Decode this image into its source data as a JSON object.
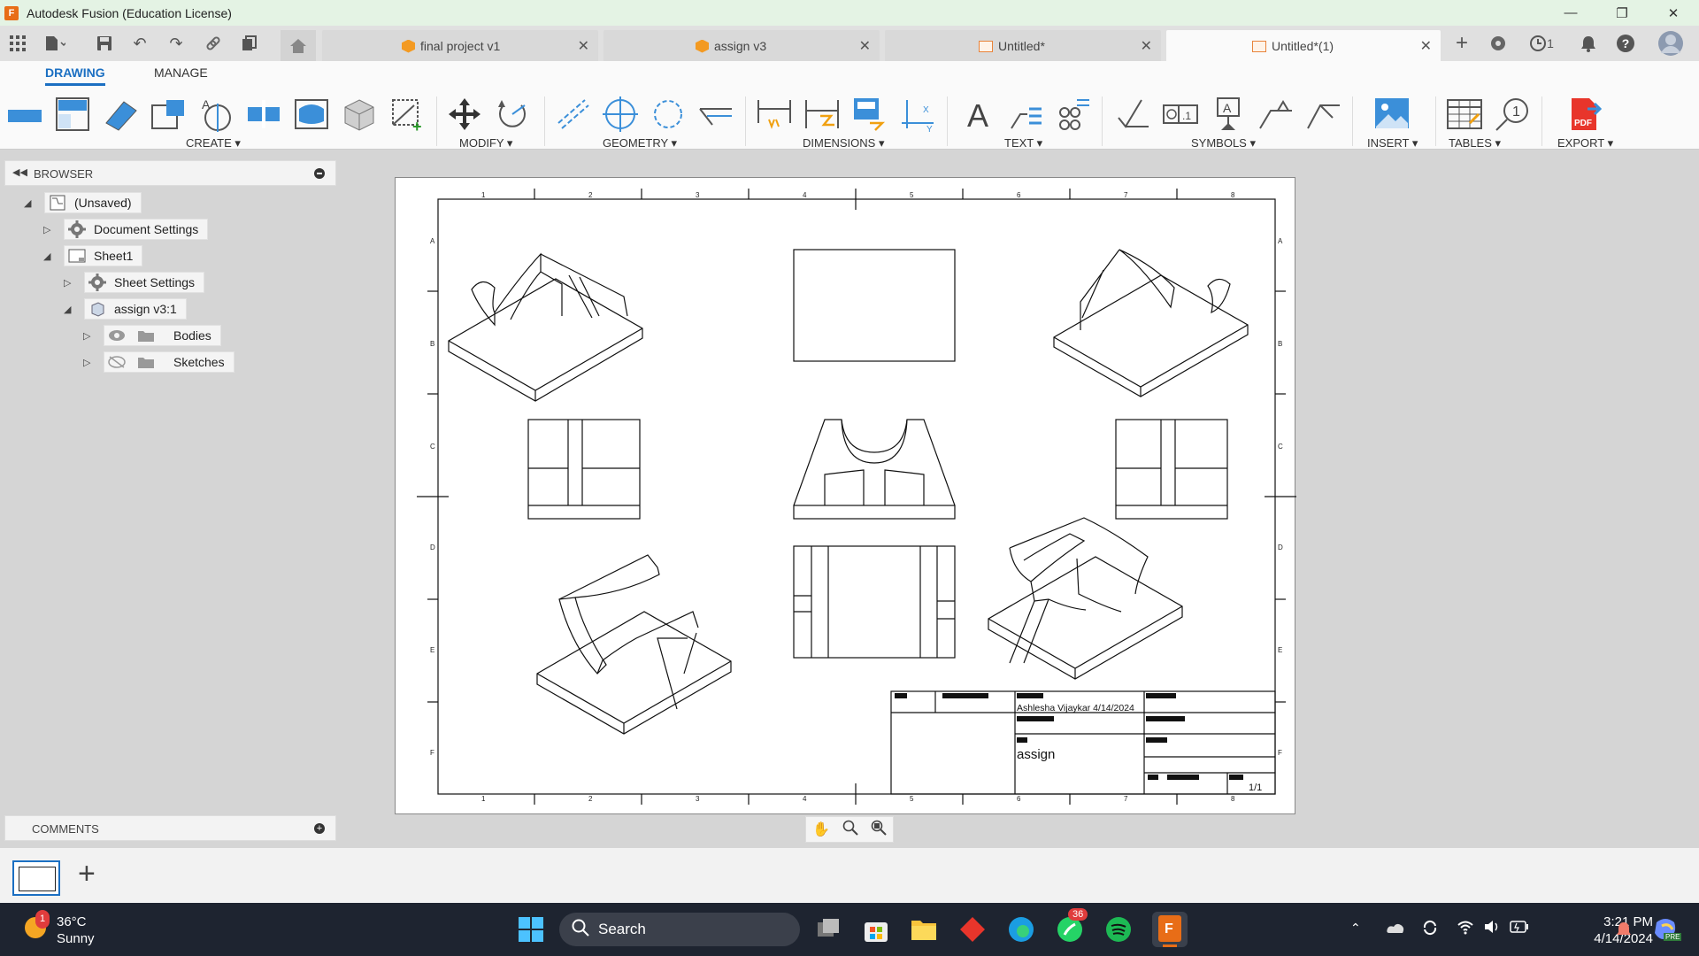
{
  "window": {
    "title": "Autodesk Fusion (Education License)",
    "app_letter": "F"
  },
  "tabs": [
    {
      "label": "final project v1",
      "active": false
    },
    {
      "label": "assign v3",
      "active": false
    },
    {
      "label": "Untitled*",
      "active": false
    },
    {
      "label": "Untitled*(1)",
      "active": true
    }
  ],
  "notifications": {
    "jobs_count": "1"
  },
  "ribbon": {
    "tabs": [
      "DRAWING",
      "MANAGE"
    ],
    "groups": {
      "create": "CREATE ▾",
      "modify": "MODIFY ▾",
      "geometry": "GEOMETRY ▾",
      "dimensions": "DIMENSIONS ▾",
      "text": "TEXT ▾",
      "symbols": "SYMBOLS ▾",
      "insert": "INSERT ▾",
      "tables": "TABLES ▾",
      "export": "EXPORT ▾"
    },
    "pdf_label": "PDF"
  },
  "browser": {
    "header": "BROWSER",
    "nodes": {
      "root": "(Unsaved)",
      "document_settings": "Document Settings",
      "sheet1": "Sheet1",
      "sheet_settings": "Sheet Settings",
      "component": "assign v3:1",
      "bodies": "Bodies",
      "sketches": "Sketches"
    }
  },
  "comments": {
    "header": "COMMENTS"
  },
  "drawing": {
    "col_labels": [
      "1",
      "2",
      "3",
      "4",
      "5",
      "6",
      "7",
      "8"
    ],
    "row_labels": [
      "A",
      "B",
      "C",
      "D",
      "E",
      "F"
    ],
    "title_block": {
      "author_date": "Ashlesha Vijaykar 4/14/2024",
      "title": "assign",
      "sheet": "1/1"
    }
  },
  "taskbar": {
    "weather_temp": "36°C",
    "weather_desc": "Sunny",
    "weather_badge": "1",
    "search_placeholder": "Search",
    "whatsapp_badge": "36",
    "time": "3:21 PM",
    "date": "4/14/2024",
    "copilot_tag": "PRE"
  }
}
